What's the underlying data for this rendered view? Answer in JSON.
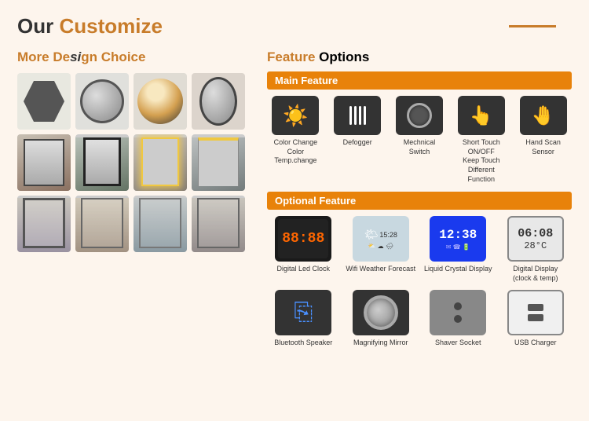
{
  "header": {
    "title_our": "Our ",
    "title_customize": "Customize"
  },
  "left": {
    "section_title_more": "More De",
    "section_title_design": "si",
    "section_title_rest": "gn Choice"
  },
  "right": {
    "section_title_feature": "Feature",
    "section_title_options": " Options",
    "main_feature_label": "Main Feature",
    "optional_feature_label": "Optional Feature",
    "main_features": [
      {
        "label": "Color Change\nColor Temp.change",
        "icon_type": "sun"
      },
      {
        "label": "Defogger",
        "icon_type": "defog"
      },
      {
        "label": "Mechnical Switch",
        "icon_type": "switch"
      },
      {
        "label": "Short Touch ON/OFF\nKeep Touch Different\nFunction",
        "icon_type": "touch"
      },
      {
        "label": "Hand Scan Sensor",
        "icon_type": "hand"
      }
    ],
    "optional_features_row1": [
      {
        "label": "Digital Led Clock",
        "icon_type": "led_clock",
        "value": "88:88"
      },
      {
        "label": "Wifi Weather Forecast",
        "icon_type": "weather"
      },
      {
        "label": "Liquid Crystal Display",
        "icon_type": "lcd",
        "value": "12:38"
      },
      {
        "label": "Digital Display\n(clock & temp)",
        "icon_type": "digital",
        "value1": "06:08",
        "value2": "28°C"
      }
    ],
    "optional_features_row2": [
      {
        "label": "Bluetooth Speaker",
        "icon_type": "bluetooth"
      },
      {
        "label": "Magnifying Mirror",
        "icon_type": "magnify"
      },
      {
        "label": "Shaver Socket",
        "icon_type": "shaver"
      },
      {
        "label": "USB Charger",
        "icon_type": "usb"
      }
    ]
  }
}
